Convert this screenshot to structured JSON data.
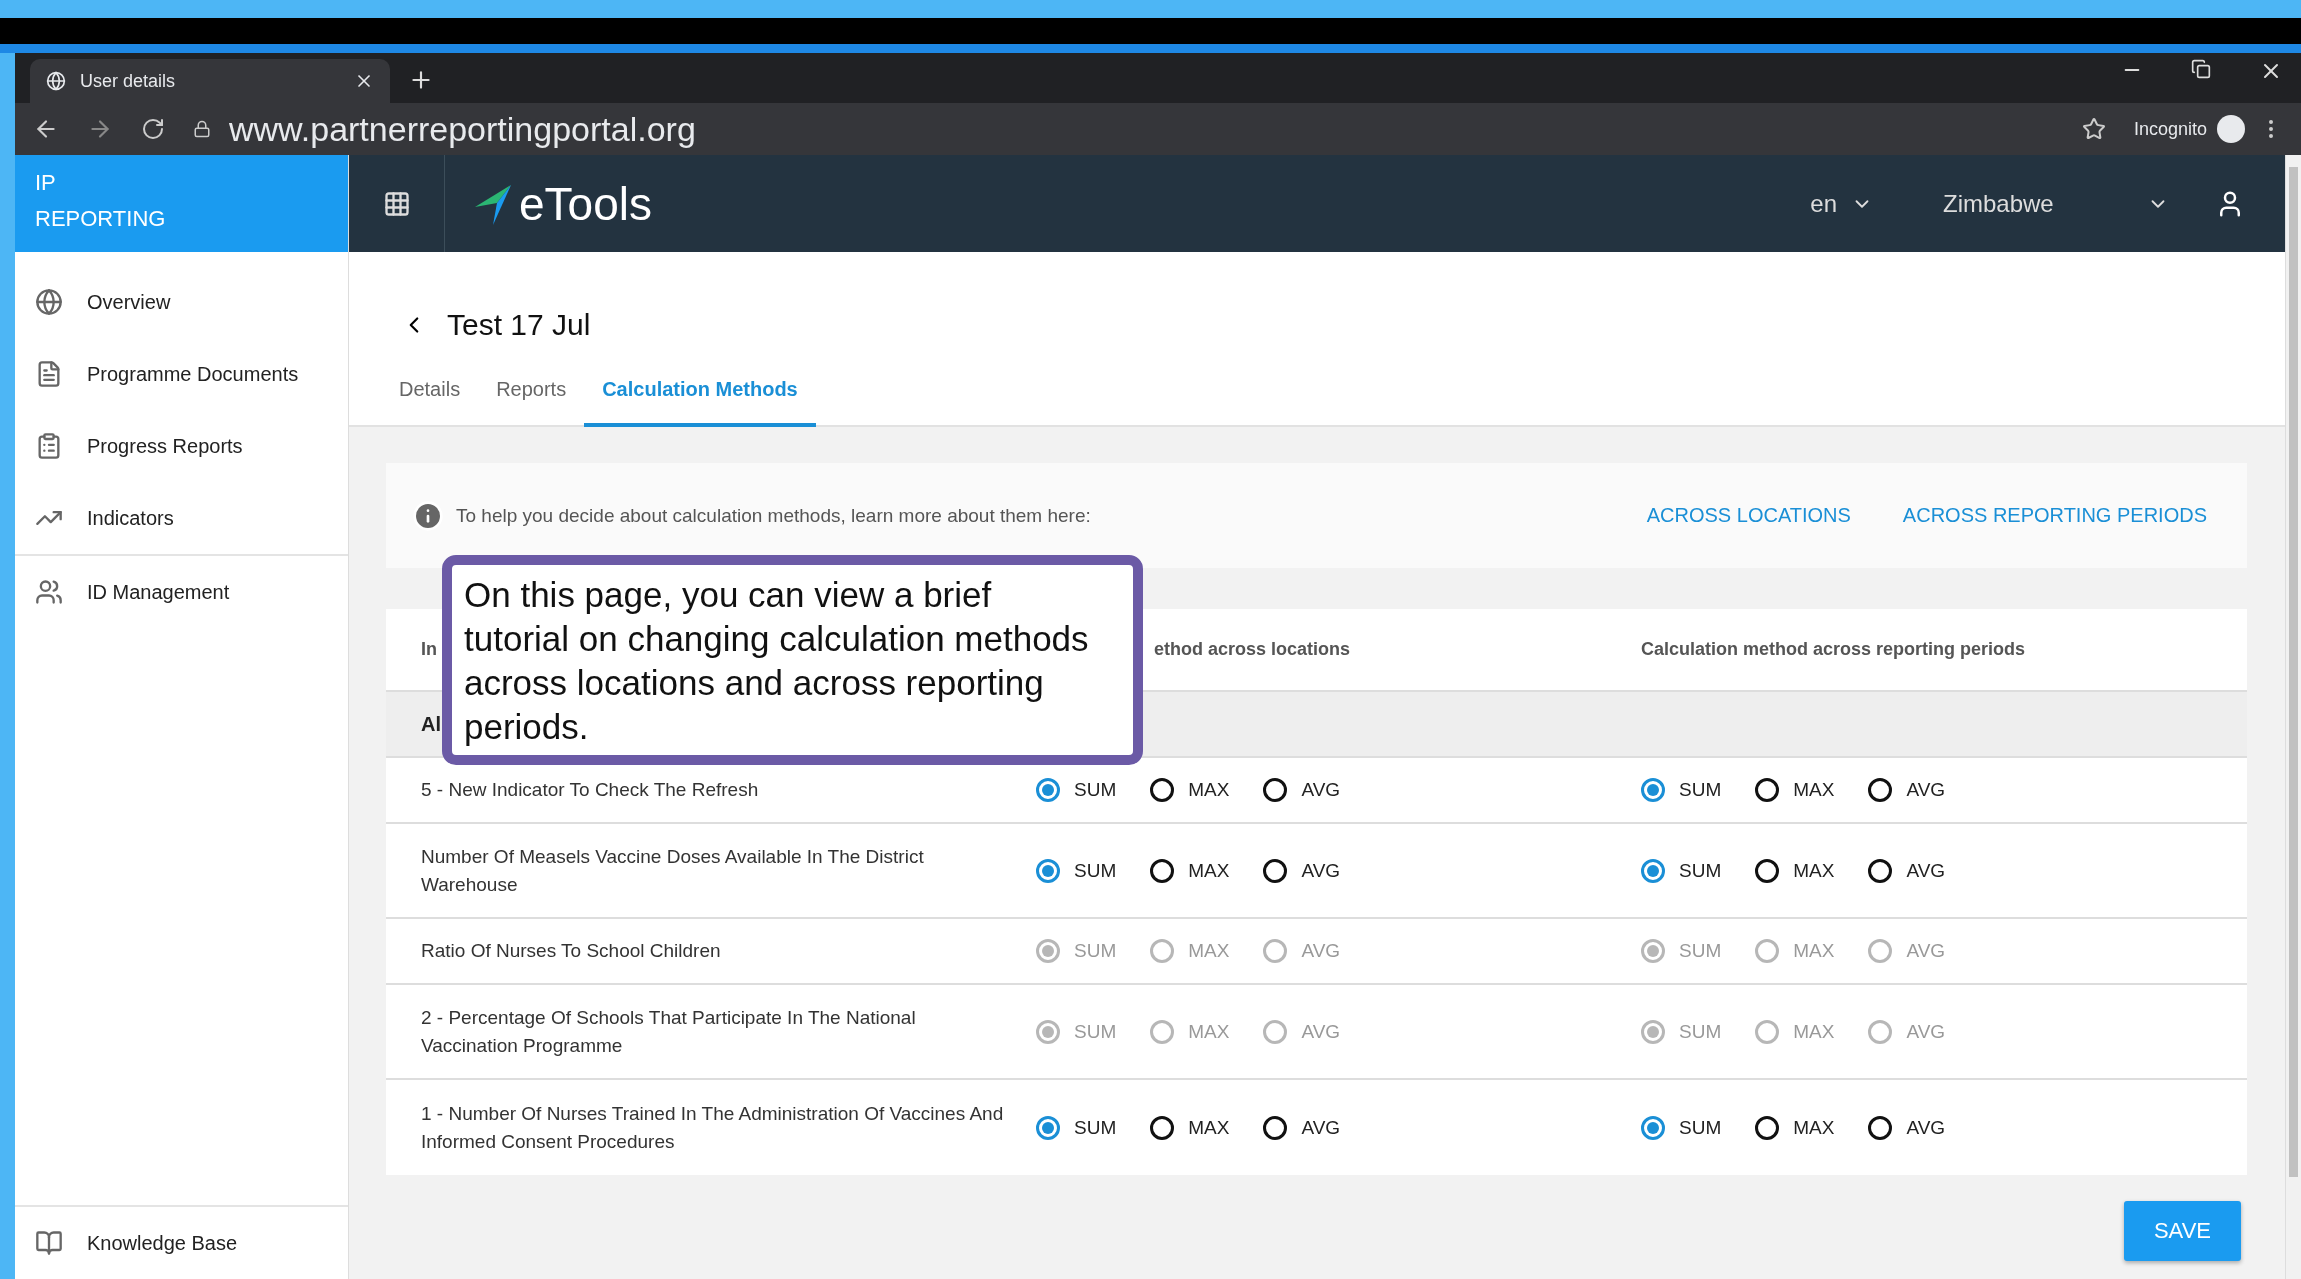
{
  "browser": {
    "tab_title": "User details",
    "url": "www.partnerreportingportal.org",
    "incognito_label": "Incognito"
  },
  "header": {
    "brand": "IP REPORTING",
    "logo_text": "eTools",
    "language": "en",
    "country": "Zimbabwe"
  },
  "sidebar": {
    "items": [
      {
        "label": "Overview",
        "selected": false
      },
      {
        "label": "Programme Documents",
        "selected": false
      },
      {
        "label": "Progress Reports",
        "selected": false
      },
      {
        "label": "Indicators",
        "selected": false
      },
      {
        "label": "ID Management",
        "selected": false
      }
    ],
    "footer_item": {
      "label": "Knowledge Base"
    }
  },
  "page": {
    "title": "Test 17 Jul",
    "tabs": [
      {
        "label": "Details",
        "selected": false
      },
      {
        "label": "Reports",
        "selected": false
      },
      {
        "label": "Calculation Methods",
        "selected": true
      }
    ],
    "info": {
      "text": "To help you decide about calculation methods, learn more about them here:",
      "links": [
        "ACROSS LOCATIONS",
        "ACROSS REPORTING PERIODS"
      ]
    },
    "table": {
      "columns": [
        "In",
        "ethod across locations",
        "Calculation method across reporting periods"
      ],
      "group_row": "Al",
      "rows": [
        {
          "name": "5 - New Indicator To Check The Refresh",
          "disabled": false,
          "locations": [
            {
              "label": "SUM",
              "selected": true
            },
            {
              "label": "MAX",
              "selected": false
            },
            {
              "label": "AVG",
              "selected": false
            }
          ],
          "periods": [
            {
              "label": "SUM",
              "selected": true
            },
            {
              "label": "MAX",
              "selected": false
            },
            {
              "label": "AVG",
              "selected": false
            }
          ]
        },
        {
          "name": "Number Of Measels Vaccine Doses Available In The District Warehouse",
          "disabled": false,
          "locations": [
            {
              "label": "SUM",
              "selected": true
            },
            {
              "label": "MAX",
              "selected": false
            },
            {
              "label": "AVG",
              "selected": false
            }
          ],
          "periods": [
            {
              "label": "SUM",
              "selected": true
            },
            {
              "label": "MAX",
              "selected": false
            },
            {
              "label": "AVG",
              "selected": false
            }
          ]
        },
        {
          "name": "Ratio Of Nurses To School Children",
          "disabled": true,
          "locations": [
            {
              "label": "SUM",
              "selected": true
            },
            {
              "label": "MAX",
              "selected": false
            },
            {
              "label": "AVG",
              "selected": false
            }
          ],
          "periods": [
            {
              "label": "SUM",
              "selected": true
            },
            {
              "label": "MAX",
              "selected": false
            },
            {
              "label": "AVG",
              "selected": false
            }
          ]
        },
        {
          "name": "2 - Percentage Of Schools That Participate In The National Vaccination Programme",
          "disabled": true,
          "locations": [
            {
              "label": "SUM",
              "selected": true
            },
            {
              "label": "MAX",
              "selected": false
            },
            {
              "label": "AVG",
              "selected": false
            }
          ],
          "periods": [
            {
              "label": "SUM",
              "selected": true
            },
            {
              "label": "MAX",
              "selected": false
            },
            {
              "label": "AVG",
              "selected": false
            }
          ]
        },
        {
          "name": "1 - Number Of Nurses Trained In The Administration Of Vaccines And Informed Consent Procedures",
          "disabled": false,
          "locations": [
            {
              "label": "SUM",
              "selected": true
            },
            {
              "label": "MAX",
              "selected": false
            },
            {
              "label": "AVG",
              "selected": false
            }
          ],
          "periods": [
            {
              "label": "SUM",
              "selected": true
            },
            {
              "label": "MAX",
              "selected": false
            },
            {
              "label": "AVG",
              "selected": false
            }
          ]
        }
      ]
    },
    "save_button": "SAVE"
  },
  "tutorial_callout": "On this page, you can view a brief tutorial on changing calculation methods across locations and across reporting periods."
}
